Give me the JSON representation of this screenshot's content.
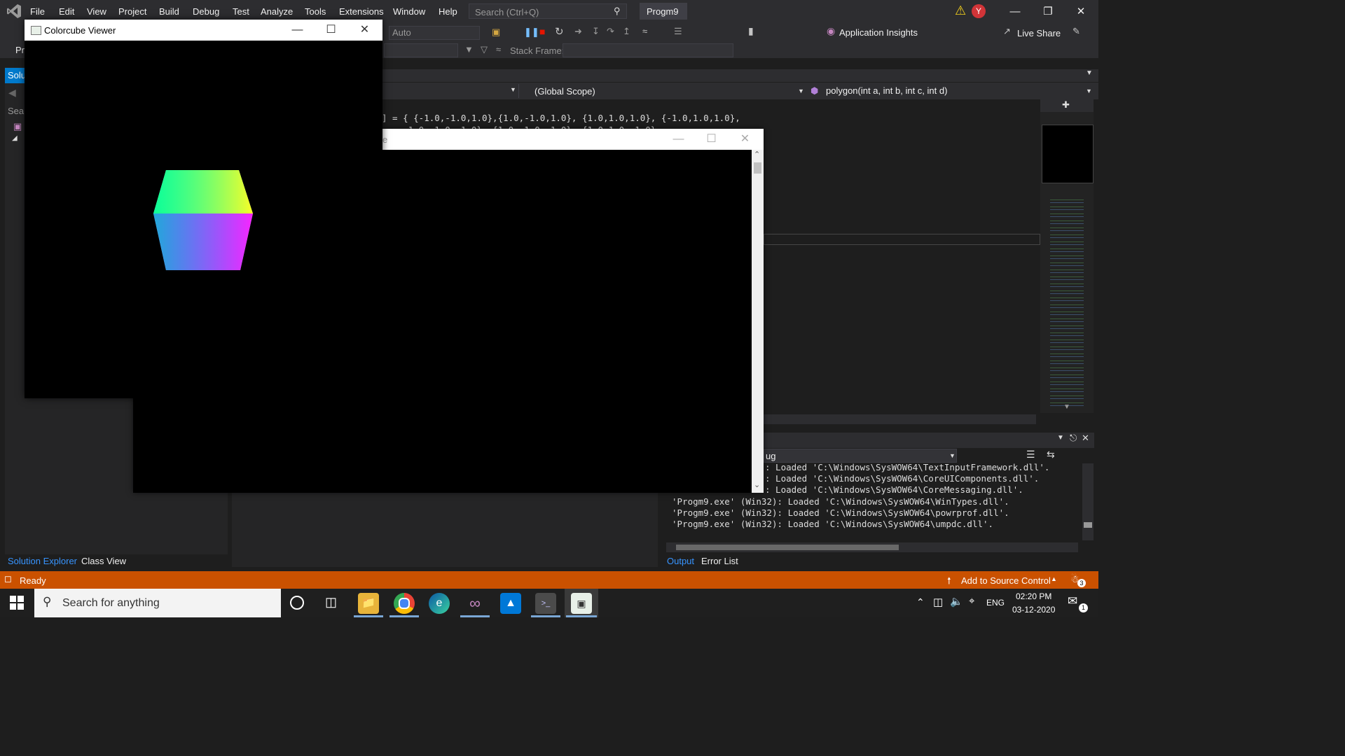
{
  "menu": {
    "items": [
      "File",
      "Edit",
      "View",
      "Project",
      "Build",
      "Debug",
      "Test",
      "Analyze",
      "Tools",
      "Extensions",
      "Window",
      "Help"
    ],
    "search_placeholder": "Search (Ctrl+Q)",
    "solution_name": "Progm9",
    "avatar_initial": "Y"
  },
  "toolbar": {
    "config_value": "Auto",
    "app_insights": "Application Insights",
    "live_share": "Live Share",
    "stack_frame_label": "Stack Frame:",
    "left_cut_text": "Pr"
  },
  "left_panel": {
    "tab_label": "Solu",
    "search_cut": "Sear",
    "bottom_tabs": [
      "Solution Explorer",
      "Class View"
    ]
  },
  "editor": {
    "scope": "(Global Scope)",
    "function": "polygon(int a, int b, int c, int d)",
    "code_line1": "] = { {-1.0,-1.0,1.0},{1.0,-1.0,1.0}, {1.0,1.0,1.0}, {-1.0,1.0,1.0},",
    "code_line2": "    -1.0,-1.0,-1.0}, {1.0,-1.0,-1.0}, {1.0,1.0,-1.0},"
  },
  "output": {
    "source_cut": "ug",
    "lines": [
      ": Loaded 'C:\\Windows\\SysWOW64\\TextInputFramework.dll'.",
      ": Loaded 'C:\\Windows\\SysWOW64\\CoreUIComponents.dll'.",
      ": Loaded 'C:\\Windows\\SysWOW64\\CoreMessaging.dll'.",
      "'Progm9.exe' (Win32): Loaded 'C:\\Windows\\SysWOW64\\WinTypes.dll'.",
      "'Progm9.exe' (Win32): Loaded 'C:\\Windows\\SysWOW64\\powrprof.dll'.",
      "'Progm9.exe' (Win32): Loaded 'C:\\Windows\\SysWOW64\\umpdc.dll'."
    ],
    "tabs": [
      "Output",
      "Error List"
    ]
  },
  "status": {
    "ready": "Ready",
    "source_control": "Add to Source Control",
    "notif_count": "3"
  },
  "console_window": {
    "title_cut": "e"
  },
  "colorcube_window": {
    "title": "Colorcube Viewer"
  },
  "taskbar": {
    "search_placeholder": "Search for anything",
    "language": "ENG",
    "time": "02:20 PM",
    "date": "03-12-2020",
    "action_center_count": "1"
  },
  "colors": {
    "accent": "#007acc",
    "status_bar": "#ca5100",
    "vs_purple": "#68217a"
  }
}
